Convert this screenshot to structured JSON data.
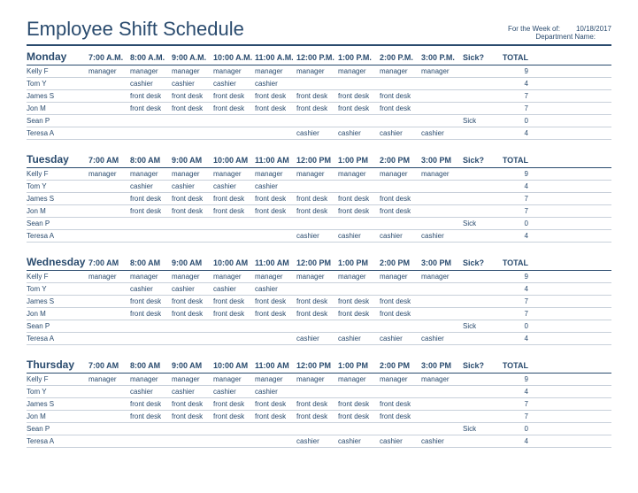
{
  "title": "Employee Shift Schedule",
  "meta": {
    "weekLabel": "For the Week of:",
    "weekValue": "10/18/2017",
    "deptLabel": "Department Name:",
    "deptValue": ""
  },
  "columns": {
    "sick": "Sick?",
    "total": "TOTAL"
  },
  "days": [
    {
      "name": "Monday",
      "times": [
        "7:00 A.M.",
        "8:00 A.M.",
        "9:00 A.M.",
        "10:00 A.M.",
        "11:00 A.M.",
        "12:00 P.M.",
        "1:00 P.M.",
        "2:00 P.M.",
        "3:00 P.M."
      ],
      "employees": [
        {
          "name": "Kelly F",
          "cells": [
            "manager",
            "manager",
            "manager",
            "manager",
            "manager",
            "manager",
            "manager",
            "manager",
            "manager"
          ],
          "sick": "",
          "total": "9"
        },
        {
          "name": "Tom Y",
          "cells": [
            "",
            "cashier",
            "cashier",
            "cashier",
            "cashier",
            "",
            "",
            "",
            ""
          ],
          "sick": "",
          "total": "4"
        },
        {
          "name": "James S",
          "cells": [
            "",
            "front desk",
            "front desk",
            "front desk",
            "front desk",
            "front desk",
            "front desk",
            "front desk",
            ""
          ],
          "sick": "",
          "total": "7"
        },
        {
          "name": "Jon M",
          "cells": [
            "",
            "front desk",
            "front desk",
            "front desk",
            "front desk",
            "front desk",
            "front desk",
            "front desk",
            ""
          ],
          "sick": "",
          "total": "7"
        },
        {
          "name": "Sean P",
          "cells": [
            "",
            "",
            "",
            "",
            "",
            "",
            "",
            "",
            ""
          ],
          "sick": "Sick",
          "total": "0"
        },
        {
          "name": "Teresa A",
          "cells": [
            "",
            "",
            "",
            "",
            "",
            "cashier",
            "cashier",
            "cashier",
            "cashier"
          ],
          "sick": "",
          "total": "4"
        }
      ]
    },
    {
      "name": "Tuesday",
      "times": [
        "7:00 AM",
        "8:00 AM",
        "9:00 AM",
        "10:00 AM",
        "11:00 AM",
        "12:00 PM",
        "1:00 PM",
        "2:00 PM",
        "3:00 PM"
      ],
      "employees": [
        {
          "name": "Kelly F",
          "cells": [
            "manager",
            "manager",
            "manager",
            "manager",
            "manager",
            "manager",
            "manager",
            "manager",
            "manager"
          ],
          "sick": "",
          "total": "9"
        },
        {
          "name": "Tom Y",
          "cells": [
            "",
            "cashier",
            "cashier",
            "cashier",
            "cashier",
            "",
            "",
            "",
            ""
          ],
          "sick": "",
          "total": "4"
        },
        {
          "name": "James S",
          "cells": [
            "",
            "front desk",
            "front desk",
            "front desk",
            "front desk",
            "front desk",
            "front desk",
            "front desk",
            ""
          ],
          "sick": "",
          "total": "7"
        },
        {
          "name": "Jon M",
          "cells": [
            "",
            "front desk",
            "front desk",
            "front desk",
            "front desk",
            "front desk",
            "front desk",
            "front desk",
            ""
          ],
          "sick": "",
          "total": "7"
        },
        {
          "name": "Sean P",
          "cells": [
            "",
            "",
            "",
            "",
            "",
            "",
            "",
            "",
            ""
          ],
          "sick": "Sick",
          "total": "0"
        },
        {
          "name": "Teresa A",
          "cells": [
            "",
            "",
            "",
            "",
            "",
            "cashier",
            "cashier",
            "cashier",
            "cashier"
          ],
          "sick": "",
          "total": "4"
        }
      ]
    },
    {
      "name": "Wednesday",
      "times": [
        "7:00 AM",
        "8:00 AM",
        "9:00 AM",
        "10:00 AM",
        "11:00 AM",
        "12:00 PM",
        "1:00 PM",
        "2:00 PM",
        "3:00 PM"
      ],
      "employees": [
        {
          "name": "Kelly F",
          "cells": [
            "manager",
            "manager",
            "manager",
            "manager",
            "manager",
            "manager",
            "manager",
            "manager",
            "manager"
          ],
          "sick": "",
          "total": "9"
        },
        {
          "name": "Tom Y",
          "cells": [
            "",
            "cashier",
            "cashier",
            "cashier",
            "cashier",
            "",
            "",
            "",
            ""
          ],
          "sick": "",
          "total": "4"
        },
        {
          "name": "James S",
          "cells": [
            "",
            "front desk",
            "front desk",
            "front desk",
            "front desk",
            "front desk",
            "front desk",
            "front desk",
            ""
          ],
          "sick": "",
          "total": "7"
        },
        {
          "name": "Jon M",
          "cells": [
            "",
            "front desk",
            "front desk",
            "front desk",
            "front desk",
            "front desk",
            "front desk",
            "front desk",
            ""
          ],
          "sick": "",
          "total": "7"
        },
        {
          "name": "Sean P",
          "cells": [
            "",
            "",
            "",
            "",
            "",
            "",
            "",
            "",
            ""
          ],
          "sick": "Sick",
          "total": "0"
        },
        {
          "name": "Teresa A",
          "cells": [
            "",
            "",
            "",
            "",
            "",
            "cashier",
            "cashier",
            "cashier",
            "cashier"
          ],
          "sick": "",
          "total": "4"
        }
      ]
    },
    {
      "name": "Thursday",
      "times": [
        "7:00 AM",
        "8:00 AM",
        "9:00 AM",
        "10:00 AM",
        "11:00 AM",
        "12:00 PM",
        "1:00 PM",
        "2:00 PM",
        "3:00 PM"
      ],
      "employees": [
        {
          "name": "Kelly F",
          "cells": [
            "manager",
            "manager",
            "manager",
            "manager",
            "manager",
            "manager",
            "manager",
            "manager",
            "manager"
          ],
          "sick": "",
          "total": "9"
        },
        {
          "name": "Tom Y",
          "cells": [
            "",
            "cashier",
            "cashier",
            "cashier",
            "cashier",
            "",
            "",
            "",
            ""
          ],
          "sick": "",
          "total": "4"
        },
        {
          "name": "James S",
          "cells": [
            "",
            "front desk",
            "front desk",
            "front desk",
            "front desk",
            "front desk",
            "front desk",
            "front desk",
            ""
          ],
          "sick": "",
          "total": "7"
        },
        {
          "name": "Jon M",
          "cells": [
            "",
            "front desk",
            "front desk",
            "front desk",
            "front desk",
            "front desk",
            "front desk",
            "front desk",
            ""
          ],
          "sick": "",
          "total": "7"
        },
        {
          "name": "Sean P",
          "cells": [
            "",
            "",
            "",
            "",
            "",
            "",
            "",
            "",
            ""
          ],
          "sick": "Sick",
          "total": "0"
        },
        {
          "name": "Teresa A",
          "cells": [
            "",
            "",
            "",
            "",
            "",
            "cashier",
            "cashier",
            "cashier",
            "cashier"
          ],
          "sick": "",
          "total": "4"
        }
      ]
    }
  ]
}
